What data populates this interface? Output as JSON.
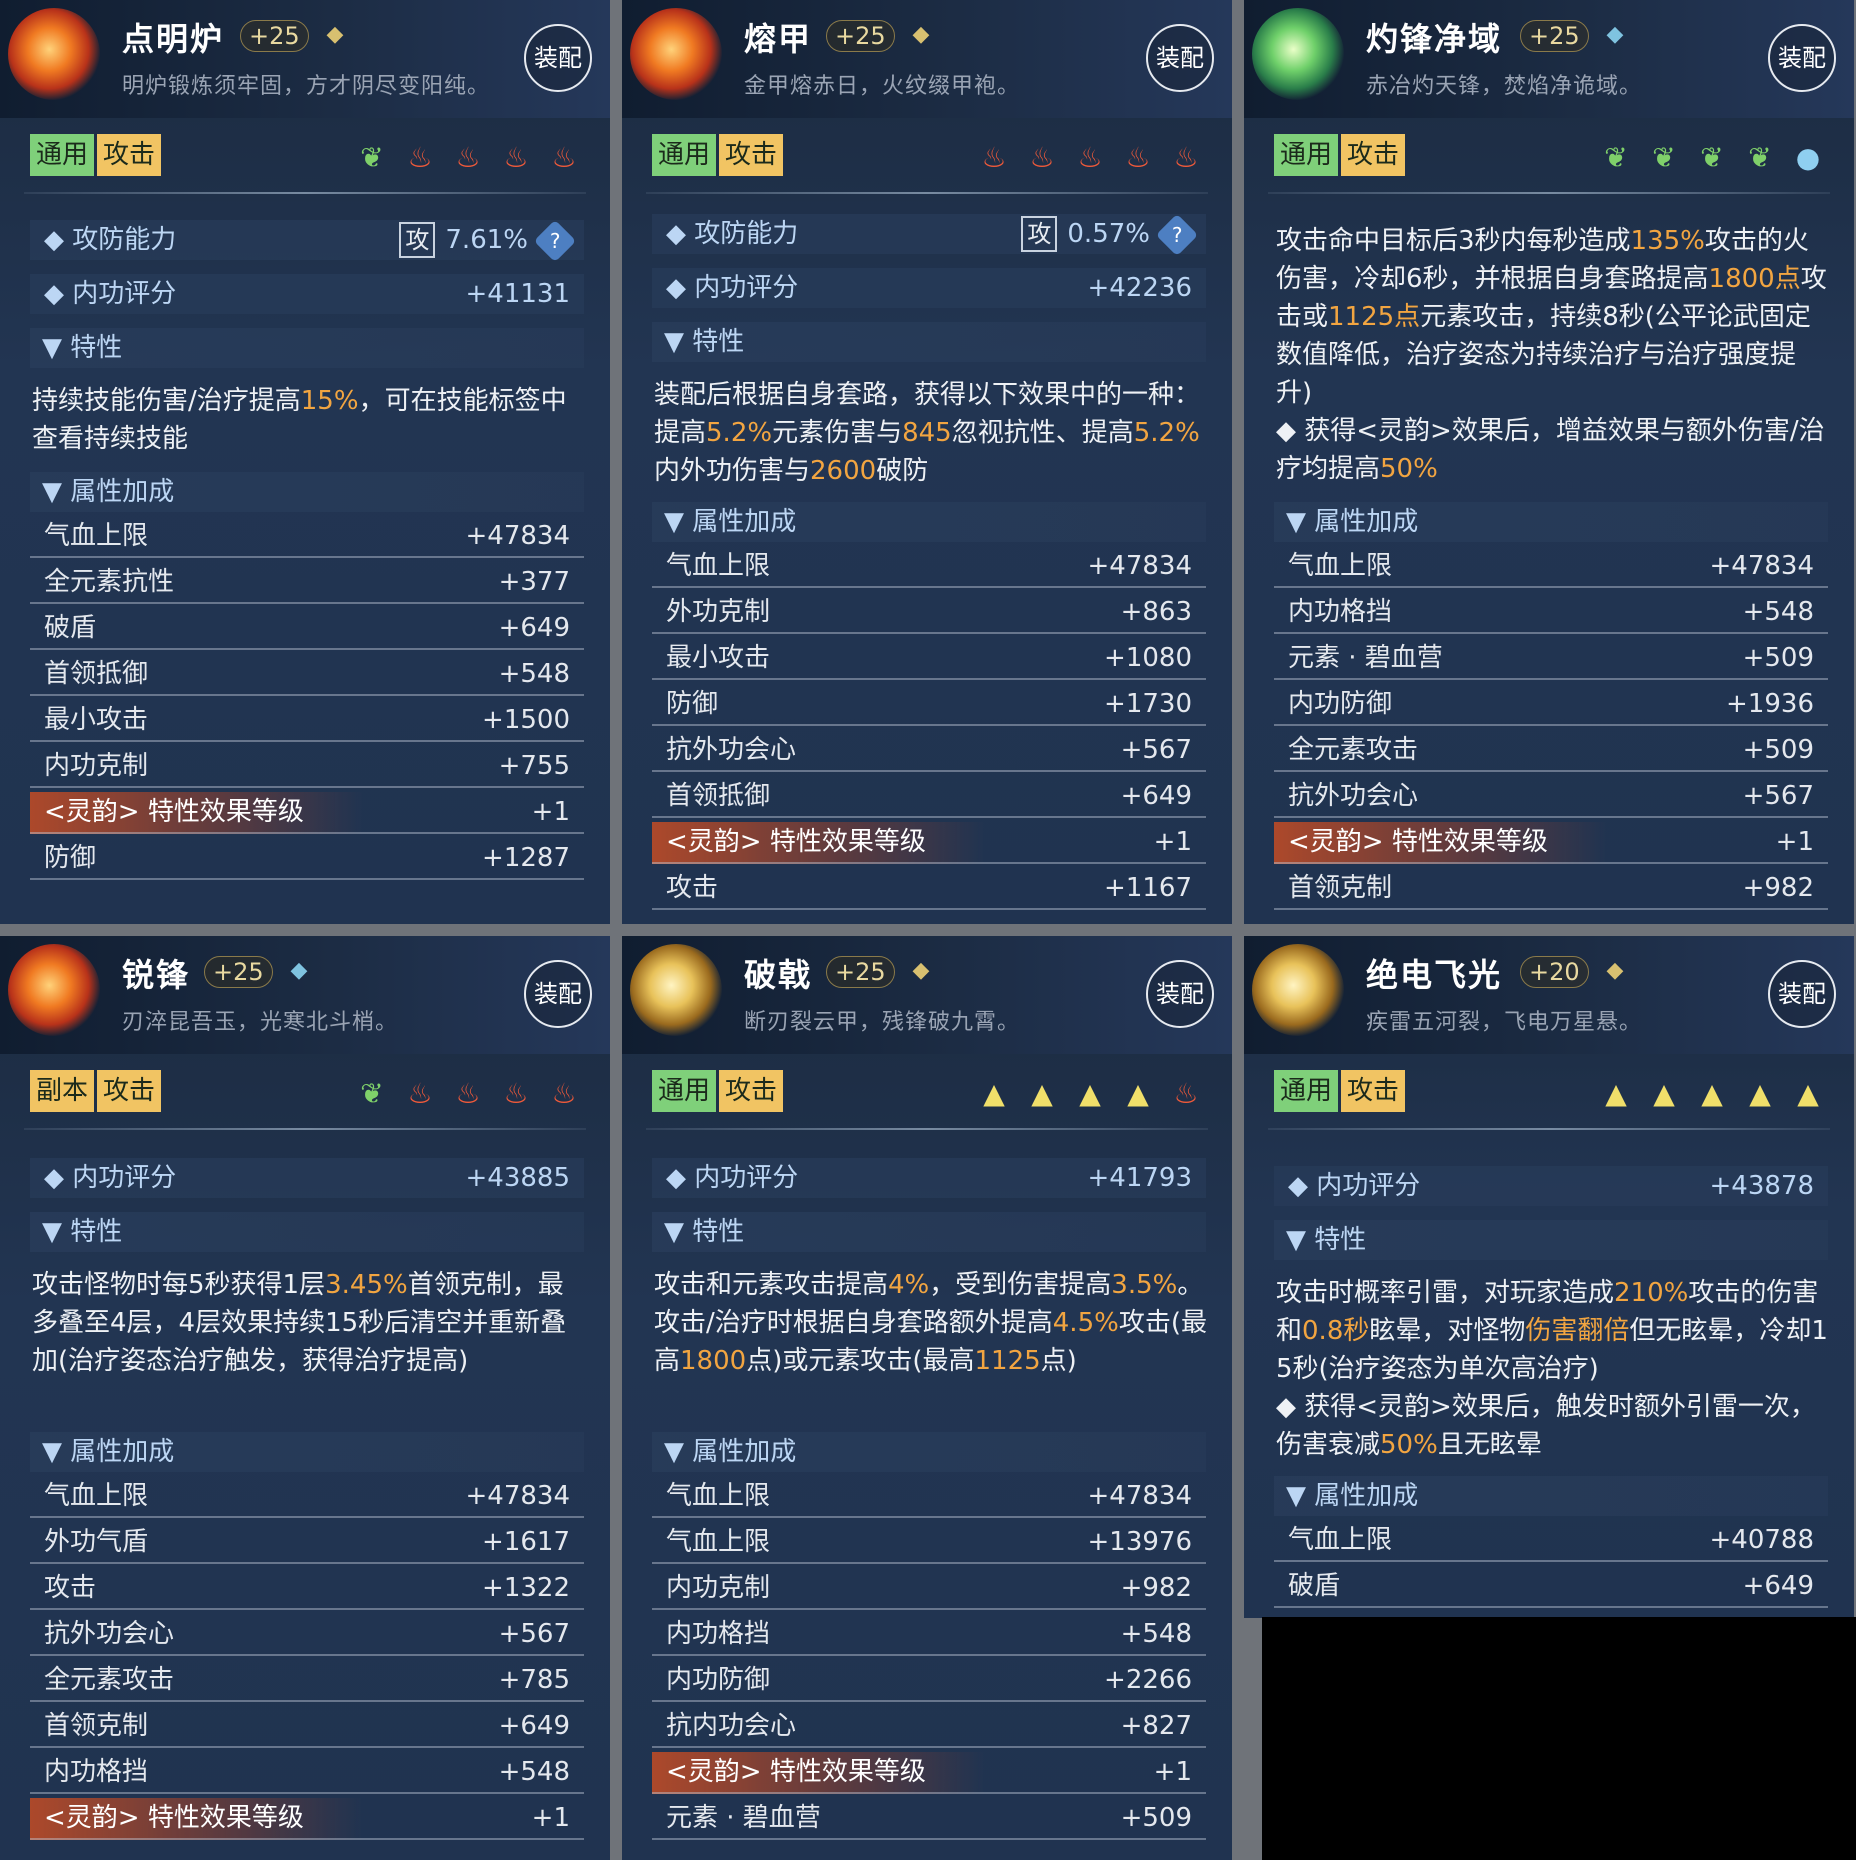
{
  "equip_label": "装配",
  "cards": [
    {
      "name": "点明炉",
      "level": "+25",
      "desc": "明炉锻炼须牢固，方才阴尽变阳纯。",
      "tags": [
        "通用",
        "攻击"
      ],
      "gems": [
        "leaf",
        "fire",
        "fire",
        "fire",
        "fire"
      ],
      "score_label": "攻防能力",
      "score_prefix": "攻",
      "score_value": "7.61%",
      "inner_label": "内功评分",
      "inner_value": "+41131",
      "trait_label": "特性",
      "trait_text": "持续技能伤害/治疗提高15%，可在技能标签中查看持续技能",
      "trait_highlight": [
        "15%"
      ],
      "attr_label": "属性加成",
      "attrs": [
        [
          "气血上限",
          "+47834"
        ],
        [
          "全元素抗性",
          "+377"
        ],
        [
          "破盾",
          "+649"
        ],
        [
          "首领抵御",
          "+548"
        ],
        [
          "最小攻击",
          "+1500"
        ],
        [
          "内功克制",
          "+755"
        ],
        [
          "<灵韵> 特性效果等级",
          "+1"
        ],
        [
          "防御",
          "+1287"
        ]
      ]
    },
    {
      "name": "熔甲",
      "level": "+25",
      "desc": "金甲熔赤日，火纹缀甲袍。",
      "tags": [
        "通用",
        "攻击"
      ],
      "gems": [
        "fire",
        "fire",
        "fire",
        "fire",
        "fire"
      ],
      "score_label": "攻防能力",
      "score_prefix": "攻",
      "score_value": "0.57%",
      "inner_label": "内功评分",
      "inner_value": "+42236",
      "trait_label": "特性",
      "trait_text": "装配后根据自身套路，获得以下效果中的一种：提高5.2%元素伤害与845忽视抗性、提高5.2%内外功伤害与2600破防",
      "trait_highlight": [
        "5.2%",
        "845",
        "5.2%",
        "2600"
      ],
      "attr_label": "属性加成",
      "attrs": [
        [
          "气血上限",
          "+47834"
        ],
        [
          "外功克制",
          "+863"
        ],
        [
          "最小攻击",
          "+1080"
        ],
        [
          "防御",
          "+1730"
        ],
        [
          "抗外功会心",
          "+567"
        ],
        [
          "首领抵御",
          "+649"
        ],
        [
          "<灵韵> 特性效果等级",
          "+1"
        ],
        [
          "攻击",
          "+1167"
        ]
      ]
    },
    {
      "name": "灼锋净域",
      "level": "+25",
      "desc": "赤冶灼天锋，焚焰净诡域。",
      "tags": [
        "通用",
        "攻击"
      ],
      "gems": [
        "leaf",
        "leaf",
        "leaf",
        "leaf",
        "water"
      ],
      "trait_text": "攻击命中目标后3秒内每秒造成135%攻击的火伤害，冷却6秒，并根据自身套路提高1800点攻击或1125点元素攻击，持续8秒(公平论武固定数值降低，治疗姿态为持续治疗与治疗强度提升)",
      "trait_text2": "◆ 获得<灵韵>效果后，增益效果与额外伤害/治疗均提高50%",
      "attr_label": "属性加成",
      "attrs": [
        [
          "气血上限",
          "+47834"
        ],
        [
          "内功格挡",
          "+548"
        ],
        [
          "元素 · 碧血营",
          "+509"
        ],
        [
          "内功防御",
          "+1936"
        ],
        [
          "全元素攻击",
          "+509"
        ],
        [
          "抗外功会心",
          "+567"
        ],
        [
          "<灵韵> 特性效果等级",
          "+1"
        ],
        [
          "首领克制",
          "+982"
        ]
      ]
    },
    {
      "name": "锐锋",
      "level": "+25",
      "desc": "刃淬昆吾玉，光寒北斗梢。",
      "tags": [
        "副本",
        "攻击"
      ],
      "gems": [
        "leaf",
        "fire",
        "fire",
        "fire",
        "fire"
      ],
      "inner_label": "内功评分",
      "inner_value": "+43885",
      "trait_label": "特性",
      "trait_text": "攻击怪物时每5秒获得1层3.45%首领克制，最多叠至4层，4层效果持续15秒后清空并重新叠加(治疗姿态治疗触发，获得治疗提高)",
      "attr_label": "属性加成",
      "attrs": [
        [
          "气血上限",
          "+47834"
        ],
        [
          "外功气盾",
          "+1617"
        ],
        [
          "攻击",
          "+1322"
        ],
        [
          "抗外功会心",
          "+567"
        ],
        [
          "全元素攻击",
          "+785"
        ],
        [
          "首领克制",
          "+649"
        ],
        [
          "内功格挡",
          "+548"
        ],
        [
          "<灵韵> 特性效果等级",
          "+1"
        ]
      ]
    },
    {
      "name": "破戟",
      "level": "+25",
      "desc": "断刃裂云甲，残锋破九霄。",
      "tags": [
        "通用",
        "攻击"
      ],
      "gems": [
        "tri",
        "tri",
        "tri",
        "tri",
        "fire"
      ],
      "inner_label": "内功评分",
      "inner_value": "+41793",
      "trait_label": "特性",
      "trait_text": "攻击和元素攻击提高4%，受到伤害提高3.5%。攻击/治疗时根据自身套路额外提高4.5%攻击(最高1800点)或元素攻击(最高1125点)",
      "attr_label": "属性加成",
      "attrs": [
        [
          "气血上限",
          "+47834"
        ],
        [
          "气血上限",
          "+13976"
        ],
        [
          "内功克制",
          "+982"
        ],
        [
          "内功格挡",
          "+548"
        ],
        [
          "内功防御",
          "+2266"
        ],
        [
          "抗内功会心",
          "+827"
        ],
        [
          "<灵韵> 特性效果等级",
          "+1"
        ],
        [
          "元素 · 碧血营",
          "+509"
        ]
      ]
    },
    {
      "name": "绝电飞光",
      "level": "+20",
      "desc": "疾雷五河裂，飞电万星悬。",
      "tags": [
        "通用",
        "攻击"
      ],
      "gems": [
        "tri",
        "tri",
        "tri",
        "tri",
        "tri"
      ],
      "inner_label": "内功评分",
      "inner_value": "+43878",
      "trait_label": "特性",
      "trait_text": "攻击时概率引雷，对玩家造成210%攻击的伤害和0.8秒眩晕，对怪物伤害翻倍但无眩晕，冷却15秒(治疗姿态为单次高治疗)",
      "trait_text2": "◆ 获得<灵韵>效果后，触发时额外引雷一次，伤害衰减50%且无眩晕",
      "attr_label": "属性加成",
      "attrs": [
        [
          "气血上限",
          "+40788"
        ],
        [
          "破盾",
          "+649"
        ]
      ]
    }
  ],
  "colors": {
    "accent_orange": "#f2a541",
    "tag_green": "#7fd07a",
    "tag_yellow": "#f1c463"
  }
}
